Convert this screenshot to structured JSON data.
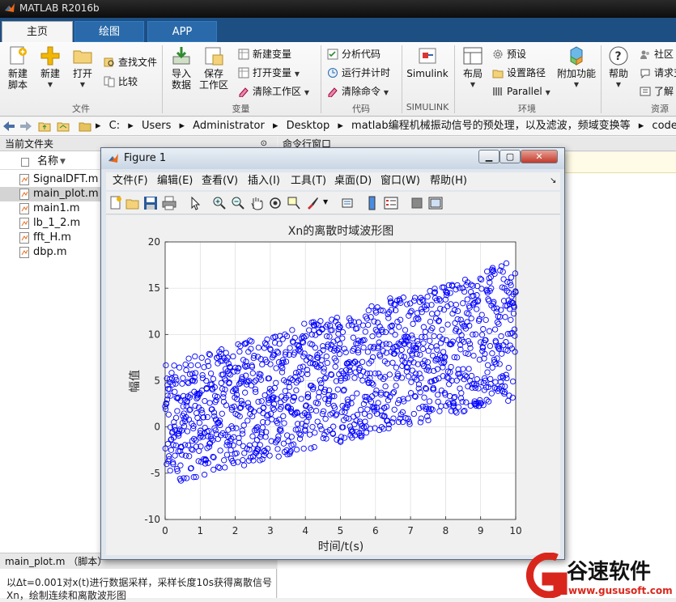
{
  "app": {
    "title": "MATLAB R2016b"
  },
  "tabs": [
    {
      "label": "主页"
    },
    {
      "label": "绘图"
    },
    {
      "label": "APP"
    }
  ],
  "ribbon": {
    "new_script": "新建\n脚本",
    "new_script_l1": "新建",
    "new_script_l2": "脚本",
    "new": "新建",
    "open": "打开",
    "find_files": "查找文件",
    "compare": "比较",
    "import_l1": "导入",
    "import_l2": "数据",
    "save_l1": "保存",
    "save_l2": "工作区",
    "new_variable": "新建变量",
    "open_variable": "打开变量",
    "clear_workspace": "清除工作区",
    "analyze_code": "分析代码",
    "run_and_time": "运行并计时",
    "clear_commands": "清除命令",
    "simulink": "Simulink",
    "layout": "布局",
    "preferences": "预设",
    "set_path": "设置路径",
    "parallel": "Parallel",
    "addons": "附加功能",
    "help": "帮助",
    "community": "社区",
    "request_support": "请求支",
    "learn": "了解",
    "groups": {
      "file": "文件",
      "variable": "变量",
      "code": "代码",
      "simulink": "SIMULINK",
      "environment": "环境",
      "resources": "资源"
    }
  },
  "address": {
    "crumbs": [
      "C:",
      "Users",
      "Administrator",
      "Desktop",
      "matlab编程机械振动信号的预处理，以及滤波，频域变换等",
      "code"
    ]
  },
  "folder_panel": {
    "title": "当前文件夹",
    "column_name": "名称",
    "files": [
      {
        "name": "SignalDFT.m"
      },
      {
        "name": "main_plot.m"
      },
      {
        "name": "main1.m"
      },
      {
        "name": "lb_1_2.m"
      },
      {
        "name": "fft_H.m"
      },
      {
        "name": "dbp.m"
      }
    ],
    "selected_index": 1
  },
  "details": {
    "title": "main_plot.m （脚本）",
    "text": "以Δt=0.001对x(t)进行数据采样，采样长度10s获得离散信号Xn，绘制连续和离散波形图"
  },
  "command_window": {
    "title": "命令行窗口"
  },
  "figure": {
    "title": "Figure 1",
    "menu": [
      "文件(F)",
      "编辑(E)",
      "查看(V)",
      "插入(I)",
      "工具(T)",
      "桌面(D)",
      "窗口(W)",
      "帮助(H)"
    ]
  },
  "chart_data": {
    "type": "scatter",
    "title": "Xn的离散时域波形图",
    "xlabel": "时间/t(s)",
    "ylabel": "幅值",
    "xlim": [
      0,
      10
    ],
    "ylim": [
      -10,
      20
    ],
    "xticks": [
      0,
      1,
      2,
      3,
      4,
      5,
      6,
      7,
      8,
      9,
      10
    ],
    "yticks": [
      -10,
      -5,
      0,
      5,
      10,
      15,
      20
    ],
    "grid": true,
    "marker": "circle",
    "color": "#0000ff",
    "series": [
      {
        "trend": {
          "x": [
            0,
            10
          ],
          "center_y": [
            0.2,
            10.5
          ],
          "spread_y": [
            6.5,
            7.5
          ]
        }
      }
    ]
  },
  "watermark": {
    "brand": "谷速软件",
    "url": "www.gususoft.com"
  },
  "colors": {
    "tab_strip": "#1e4f82",
    "marker": "#0000ff",
    "watermark_red": "#d9261c"
  }
}
